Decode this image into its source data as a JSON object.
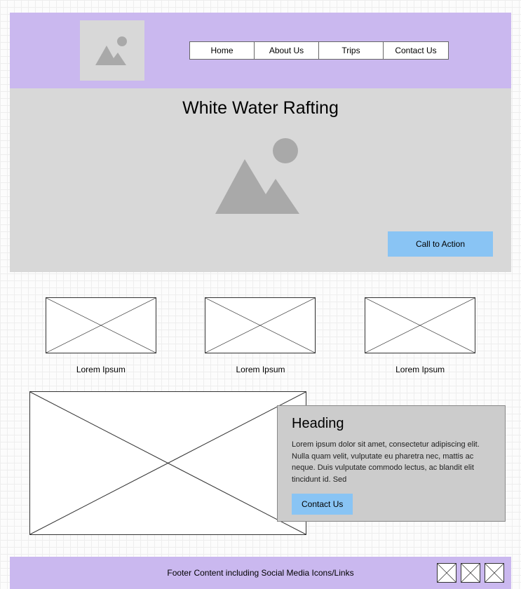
{
  "nav": {
    "items": [
      {
        "label": "Home"
      },
      {
        "label": "About Us"
      },
      {
        "label": "Trips"
      },
      {
        "label": "Contact Us"
      }
    ]
  },
  "hero": {
    "title": "White Water Rafting",
    "cta_label": "Call to Action"
  },
  "cards": [
    {
      "label": "Lorem Ipsum"
    },
    {
      "label": "Lorem Ipsum"
    },
    {
      "label": "Lorem Ipsum"
    }
  ],
  "feature": {
    "heading": "Heading",
    "body": "Lorem ipsum dolor sit amet, consectetur adipiscing elit. Nulla quam velit, vulputate eu pharetra nec, mattis ac neque. Duis vulputate commodo lectus, ac blandit elit tincidunt id. Sed",
    "button_label": "Contact Us"
  },
  "footer": {
    "text": "Footer Content including Social Media Icons/Links"
  }
}
